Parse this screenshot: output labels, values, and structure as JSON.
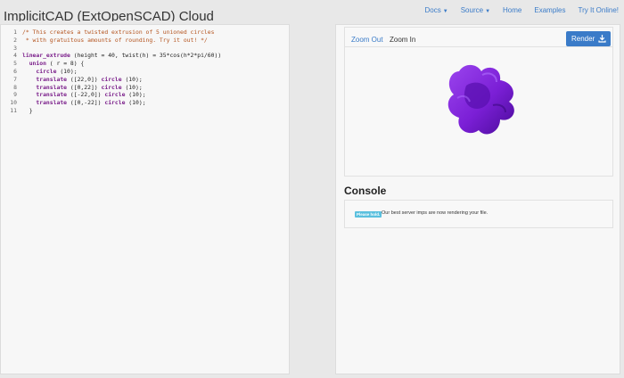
{
  "header": {
    "title": "ImplicitCAD (ExtOpenSCAD) Cloud",
    "nav": [
      {
        "label": "Docs",
        "dropdown": true
      },
      {
        "label": "Source",
        "dropdown": true
      },
      {
        "label": "Home",
        "dropdown": false
      },
      {
        "label": "Examples",
        "dropdown": false
      },
      {
        "label": "Try It Online!",
        "dropdown": false
      }
    ]
  },
  "editor": {
    "lines": [
      {
        "num": "1",
        "tokens": [
          {
            "t": "/* This creates a twisted extrusion of 5 unioned circles",
            "c": "comment"
          }
        ]
      },
      {
        "num": "2",
        "tokens": [
          {
            "t": " * with gratuitous amounts of rounding. Try it out! */",
            "c": "comment"
          }
        ]
      },
      {
        "num": "3",
        "tokens": []
      },
      {
        "num": "4",
        "tokens": [
          {
            "t": "linear_extrude",
            "c": "kw"
          },
          {
            "t": " (height = 40, twist(h) = 35*cos(h*2*pi/60))",
            "c": "plain"
          }
        ]
      },
      {
        "num": "5",
        "tokens": [
          {
            "t": "  ",
            "c": "plain"
          },
          {
            "t": "union",
            "c": "kw"
          },
          {
            "t": " ( r = 8) {",
            "c": "plain"
          }
        ]
      },
      {
        "num": "6",
        "tokens": [
          {
            "t": "    ",
            "c": "plain"
          },
          {
            "t": "circle",
            "c": "kw"
          },
          {
            "t": " (10);",
            "c": "plain"
          }
        ]
      },
      {
        "num": "7",
        "tokens": [
          {
            "t": "    ",
            "c": "plain"
          },
          {
            "t": "translate",
            "c": "kw"
          },
          {
            "t": " ([22,0]) ",
            "c": "plain"
          },
          {
            "t": "circle",
            "c": "kw"
          },
          {
            "t": " (10);",
            "c": "plain"
          }
        ]
      },
      {
        "num": "8",
        "tokens": [
          {
            "t": "    ",
            "c": "plain"
          },
          {
            "t": "translate",
            "c": "kw"
          },
          {
            "t": " ([0,22]) ",
            "c": "plain"
          },
          {
            "t": "circle",
            "c": "kw"
          },
          {
            "t": " (10);",
            "c": "plain"
          }
        ]
      },
      {
        "num": "9",
        "tokens": [
          {
            "t": "    ",
            "c": "plain"
          },
          {
            "t": "translate",
            "c": "kw"
          },
          {
            "t": " ([-22,0]) ",
            "c": "plain"
          },
          {
            "t": "circle",
            "c": "kw"
          },
          {
            "t": " (10);",
            "c": "plain"
          }
        ]
      },
      {
        "num": "10",
        "tokens": [
          {
            "t": "    ",
            "c": "plain"
          },
          {
            "t": "translate",
            "c": "kw"
          },
          {
            "t": " ([0,-22]) ",
            "c": "plain"
          },
          {
            "t": "circle",
            "c": "kw"
          },
          {
            "t": " (10);",
            "c": "plain"
          }
        ]
      },
      {
        "num": "11",
        "tokens": [
          {
            "t": "  }",
            "c": "plain"
          }
        ]
      }
    ]
  },
  "viewer": {
    "zoom_out_label": "Zoom Out",
    "zoom_in_label": "Zoom In",
    "render_label": "Render",
    "model_color": "#7b1fd6"
  },
  "console": {
    "title": "Console",
    "badge": "Please hold.",
    "message": "Our best server imps are now rendering your file."
  },
  "colors": {
    "accent": "#3a7bc8",
    "badge": "#5bc0de"
  }
}
